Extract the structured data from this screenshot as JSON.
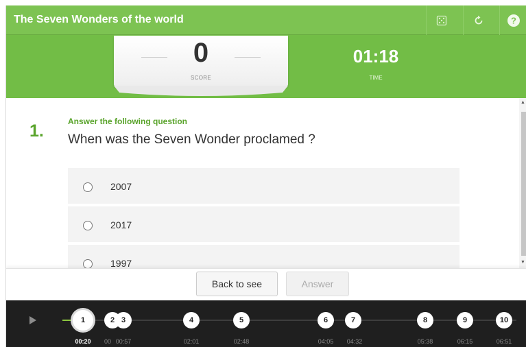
{
  "header": {
    "title": "The Seven Wonders of the world",
    "buttons": [
      {
        "name": "dice-icon"
      },
      {
        "name": "restart-icon"
      },
      {
        "name": "help-icon"
      }
    ]
  },
  "score": {
    "value": "0",
    "label": "SCORE"
  },
  "timer": {
    "value": "01:18",
    "label": "TIME"
  },
  "question": {
    "number": "1.",
    "instruction": "Answer the following question",
    "text": "When was the Seven Wonder proclamed ?",
    "options": [
      "2007",
      "2017",
      "1997"
    ]
  },
  "actions": {
    "back_label": "Back to see",
    "answer_label": "Answer"
  },
  "timeline": {
    "nodes": [
      {
        "label": "1",
        "time": "00:20",
        "current": true
      },
      {
        "label": "2",
        "time": "00",
        "current": false
      },
      {
        "label": "3",
        "time": "00:57",
        "current": false
      },
      {
        "label": "4",
        "time": "02:01",
        "current": false
      },
      {
        "label": "5",
        "time": "02:48",
        "current": false
      },
      {
        "label": "6",
        "time": "04:05",
        "current": false
      },
      {
        "label": "7",
        "time": "04:32",
        "current": false
      },
      {
        "label": "8",
        "time": "05:38",
        "current": false
      },
      {
        "label": "9",
        "time": "06:15",
        "current": false
      },
      {
        "label": "10",
        "time": "06:51",
        "current": false
      }
    ]
  },
  "colors": {
    "brand_green": "#7dc352",
    "question_green": "#5aa42c",
    "timeline_bg": "#1f1f1f"
  }
}
